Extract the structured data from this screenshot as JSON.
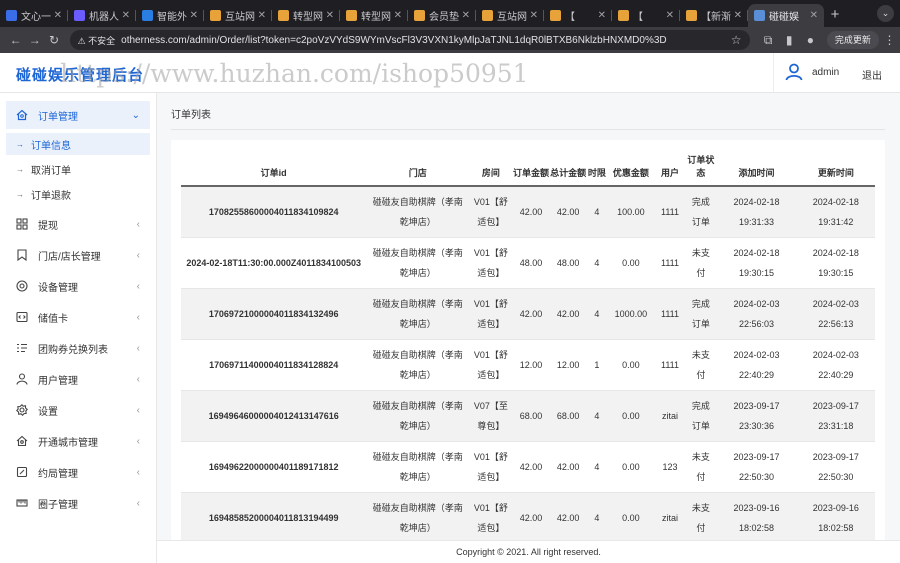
{
  "browser": {
    "tabs": [
      {
        "title": "文心一",
        "color": "#3a6ee8"
      },
      {
        "title": "机器人",
        "color": "#6a5cff"
      },
      {
        "title": "智能外",
        "color": "#2a7de1"
      },
      {
        "title": "互站网",
        "color": "#e8a23a"
      },
      {
        "title": "转型网",
        "color": "#e8a23a"
      },
      {
        "title": "转型网",
        "color": "#e8a23a"
      },
      {
        "title": "会员垫",
        "color": "#e8a23a"
      },
      {
        "title": "互站网",
        "color": "#e8a23a"
      },
      {
        "title": "【",
        "color": "#e8a23a"
      },
      {
        "title": "【",
        "color": "#e8a23a"
      },
      {
        "title": "【新渐",
        "color": "#e8a23a"
      },
      {
        "title": "碰碰娱",
        "color": "#5a8fd8"
      }
    ],
    "address": {
      "security_label": "不安全",
      "url": "otherness.com/admin/Order/list?token=c2poVzVYdS9WYmVscFl3V3VXN1kyMlpJaTJNL1dqR0lBTXB6NklzbHNXMD0%3D"
    },
    "update_label": "完成更新"
  },
  "header": {
    "brand": "碰碰娱乐管理后台",
    "watermark": "https://www.huzhan.com/ishop50951",
    "username": "admin",
    "logout": "退出"
  },
  "sidebar": {
    "expanded": {
      "label": "订单管理",
      "items": [
        "订单信息",
        "取消订单",
        "订单退款"
      ]
    },
    "items": [
      {
        "label": "提现",
        "icon": "grid-icon"
      },
      {
        "label": "门店/店长管理",
        "icon": "bookmark-icon"
      },
      {
        "label": "设备管理",
        "icon": "target-icon"
      },
      {
        "label": "储值卡",
        "icon": "code-icon"
      },
      {
        "label": "团购券兑换列表",
        "icon": "list-icon"
      },
      {
        "label": "用户管理",
        "icon": "user-icon"
      },
      {
        "label": "设置",
        "icon": "gear-icon"
      },
      {
        "label": "开通城市管理",
        "icon": "home-icon"
      },
      {
        "label": "约局管理",
        "icon": "edit-icon"
      },
      {
        "label": "圈子管理",
        "icon": "ruler-icon"
      }
    ]
  },
  "main": {
    "title": "订单列表",
    "table": {
      "headers": [
        "订单id",
        "门店",
        "房间",
        "订单金额",
        "总计金额",
        "时限",
        "优惠金额",
        "用户",
        "订单状态",
        "添加时间",
        "更新时间"
      ],
      "rows": [
        [
          "17082558600004011834109824",
          "碰碰友自助棋牌（孝南乾坤店）",
          "V01【舒适包】",
          "42.00",
          "42.00",
          "4",
          "100.00",
          "1111",
          "完成订单",
          "2024-02-18 19:31:33",
          "2024-02-18 19:31:42"
        ],
        [
          "2024-02-18T11:30:00.000Z4011834100503",
          "碰碰友自助棋牌（孝南乾坤店）",
          "V01【舒适包】",
          "48.00",
          "48.00",
          "4",
          "0.00",
          "1111",
          "未支付",
          "2024-02-18 19:30:15",
          "2024-02-18 19:30:15"
        ],
        [
          "17069721000004011834132496",
          "碰碰友自助棋牌（孝南乾坤店）",
          "V01【舒适包】",
          "42.00",
          "42.00",
          "4",
          "1000.00",
          "1111",
          "完成订单",
          "2024-02-03 22:56:03",
          "2024-02-03 22:56:13"
        ],
        [
          "17069711400004011834128824",
          "碰碰友自助棋牌（孝南乾坤店）",
          "V01【舒适包】",
          "12.00",
          "12.00",
          "1",
          "0.00",
          "1111",
          "未支付",
          "2024-02-03 22:40:29",
          "2024-02-03 22:40:29"
        ],
        [
          "16949646000004012413147616",
          "碰碰友自助棋牌（孝南乾坤店）",
          "V07【至尊包】",
          "68.00",
          "68.00",
          "4",
          "0.00",
          "zitai",
          "完成订单",
          "2023-09-17 23:30:36",
          "2023-09-17 23:31:18"
        ],
        [
          "16949622000000401189171812",
          "碰碰友自助棋牌（孝南乾坤店）",
          "V01【舒适包】",
          "42.00",
          "42.00",
          "4",
          "0.00",
          "123",
          "未支付",
          "2023-09-17 22:50:30",
          "2023-09-17 22:50:30"
        ],
        [
          "16948585200004011813194499",
          "碰碰友自助棋牌（孝南乾坤店）",
          "V01【舒适包】",
          "42.00",
          "42.00",
          "4",
          "0.00",
          "zitai",
          "未支付",
          "2023-09-16 18:02:58",
          "2023-09-16 18:02:58"
        ]
      ]
    }
  },
  "footer": {
    "copyright": "Copyright © 2021. All right reserved."
  },
  "colors": {
    "accent": "#1e66d6",
    "active_bg": "#eaf1fb"
  }
}
